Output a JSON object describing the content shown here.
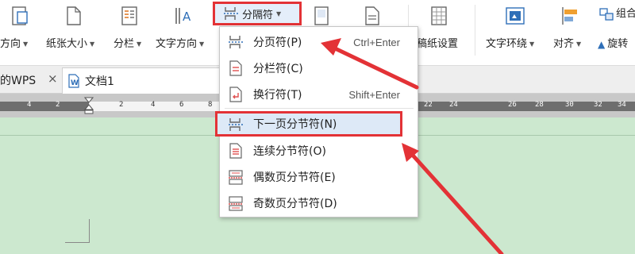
{
  "ribbon": {
    "labels": {
      "orientation": "方向",
      "paper_size": "纸张大小",
      "columns": "分栏",
      "text_direction": "文字方向",
      "breaks": "分隔符",
      "grid_paper": "稿纸设置",
      "text_wrap": "文字环绕",
      "align": "对齐",
      "group": "组合",
      "rotate": "旋转"
    }
  },
  "tabs": {
    "home": "的WPS",
    "close_glyph": "×",
    "document": "文档1"
  },
  "ruler": {
    "numbers": [
      "4",
      "2",
      "2",
      "4",
      "6",
      "8",
      "22",
      "24",
      "26",
      "28",
      "30",
      "32",
      "34"
    ]
  },
  "menu": {
    "items": [
      {
        "label": "分页符(P)",
        "shortcut": "Ctrl+Enter",
        "icon": "page-break-icon"
      },
      {
        "label": "分栏符(C)",
        "shortcut": "",
        "icon": "column-break-icon"
      },
      {
        "label": "换行符(T)",
        "shortcut": "Shift+Enter",
        "icon": "line-break-icon"
      },
      {
        "label": "下一页分节符(N)",
        "shortcut": "",
        "icon": "next-page-section-break-icon",
        "highlighted": true
      },
      {
        "label": "连续分节符(O)",
        "shortcut": "",
        "icon": "continuous-section-break-icon"
      },
      {
        "label": "偶数页分节符(E)",
        "shortcut": "",
        "icon": "even-page-section-break-icon"
      },
      {
        "label": "奇数页分节符(D)",
        "shortcut": "",
        "icon": "odd-page-section-break-icon"
      }
    ]
  },
  "colors": {
    "annotation_red": "#e33236",
    "document_background": "#cce8cf",
    "menu_highlight": "#dde9f7"
  }
}
